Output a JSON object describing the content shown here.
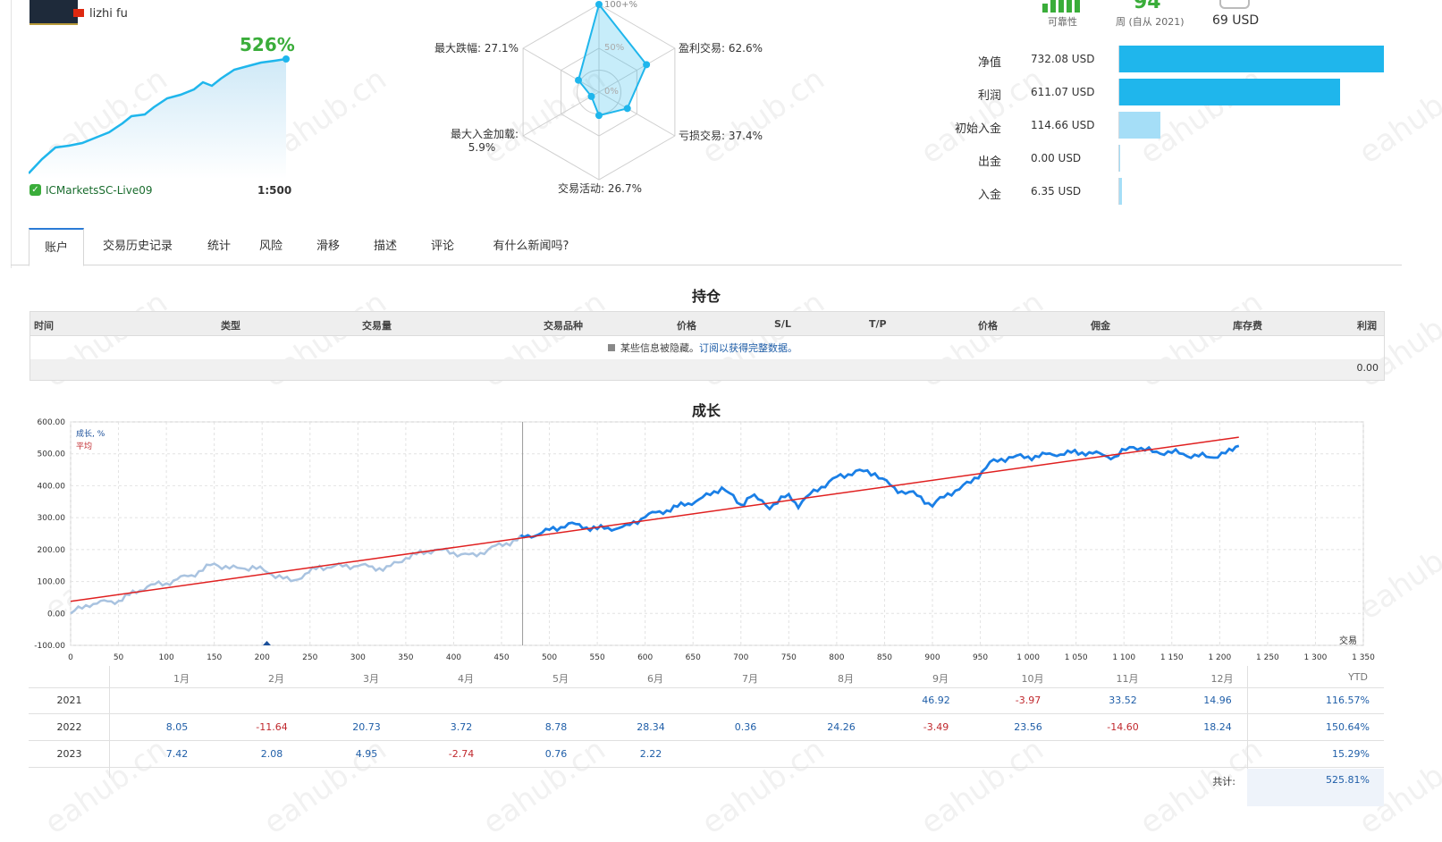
{
  "profile": {
    "user_name": "lizhi fu",
    "growth_pct": "526%",
    "server": "ICMarketsSC-Live09",
    "leverage": "1:500"
  },
  "radar": {
    "labels": {
      "top": "100+%",
      "mid": "50%",
      "center": "0%",
      "drawdown": "最大跌幅: 27.1%",
      "profit_trades": "盈利交易: 62.6%",
      "loss_trades": "亏损交易: 37.4%",
      "deposit_load_line1": "最大入金加载:",
      "deposit_load_line2": "5.9%",
      "activity": "交易活动: 26.7%"
    },
    "values": [
      100,
      62.6,
      37.4,
      26.7,
      5.9,
      27.1
    ]
  },
  "stats": {
    "reliability_label": "可靠性",
    "weeks_value": "94",
    "weeks_label": "周 (自从 2021)",
    "price_value": "69 USD"
  },
  "financials": [
    {
      "label": "净值",
      "value": "732.08 USD",
      "ratio": 1.0,
      "color": "#1fb6ec"
    },
    {
      "label": "利润",
      "value": "611.07 USD",
      "ratio": 0.835,
      "color": "#1fb6ec"
    },
    {
      "label": "初始入金",
      "value": "114.66 USD",
      "ratio": 0.157,
      "color": "#a5def7"
    },
    {
      "label": "出金",
      "value": "0.00 USD",
      "ratio": 0.0,
      "color": "#a5def7"
    },
    {
      "label": "入金",
      "value": "6.35 USD",
      "ratio": 0.009,
      "color": "#a5def7"
    }
  ],
  "tabs": [
    "账户",
    "交易历史记录",
    "统计",
    "风险",
    "滑移",
    "描述",
    "评论",
    "有什么新闻吗?"
  ],
  "positions": {
    "title": "持仓",
    "columns": [
      "时间",
      "类型",
      "交易量",
      "交易品种",
      "价格",
      "S/L",
      "T/P",
      "价格",
      "佣金",
      "库存费",
      "利润"
    ],
    "hidden_notice_prefix": "某些信息被隐藏。",
    "hidden_notice_link": "订阅以获得完整数据。",
    "total": "0.00"
  },
  "growth": {
    "title": "成长",
    "legend_growth": "成长, %",
    "legend_avg": "平均",
    "x_axis_label": "交易",
    "y_ticks": [
      "600.00",
      "500.00",
      "400.00",
      "300.00",
      "200.00",
      "100.00",
      "0.00",
      "-100.00"
    ],
    "x_ticks": [
      "0",
      "50",
      "100",
      "150",
      "200",
      "250",
      "300",
      "350",
      "400",
      "450",
      "500",
      "550",
      "600",
      "650",
      "700",
      "750",
      "800",
      "850",
      "900",
      "950",
      "1 000",
      "1 050",
      "1 100",
      "1 150",
      "1 200",
      "1 250",
      "1 300",
      "1 350"
    ]
  },
  "chart_data": {
    "type": "line",
    "title": "成长",
    "xlabel": "交易",
    "ylabel": "",
    "xlim": [
      0,
      1350
    ],
    "ylim": [
      -100,
      600
    ],
    "series": [
      {
        "name": "成长, %",
        "x": [
          0,
          20,
          50,
          80,
          100,
          130,
          150,
          170,
          190,
          210,
          230,
          260,
          300,
          330,
          350,
          380,
          400,
          420,
          440,
          470,
          500,
          520,
          550,
          580,
          600,
          630,
          660,
          680,
          700,
          710,
          730,
          750,
          760,
          780,
          800,
          820,
          840,
          860,
          880,
          900,
          920,
          940,
          960,
          980,
          1000,
          1030,
          1060,
          1090,
          1110,
          1130,
          1150,
          1170,
          1190,
          1210,
          1220
        ],
        "y": [
          0,
          30,
          40,
          85,
          95,
          125,
          155,
          140,
          145,
          125,
          100,
          145,
          150,
          140,
          175,
          200,
          190,
          180,
          205,
          235,
          260,
          280,
          265,
          270,
          305,
          330,
          360,
          395,
          340,
          370,
          335,
          370,
          340,
          390,
          425,
          445,
          440,
          390,
          375,
          340,
          380,
          410,
          470,
          490,
          490,
          500,
          505,
          490,
          525,
          505,
          505,
          495,
          490,
          505,
          525
        ]
      },
      {
        "name": "平均",
        "x": [
          0,
          1220
        ],
        "y": [
          38,
          552
        ]
      }
    ]
  },
  "monthly": {
    "months": [
      "1月",
      "2月",
      "3月",
      "4月",
      "5月",
      "6月",
      "7月",
      "8月",
      "9月",
      "10月",
      "11月",
      "12月"
    ],
    "ytd_label": "YTD",
    "rows": [
      {
        "year": "2021",
        "values": [
          "",
          "",
          "",
          "",
          "",
          "",
          "",
          "",
          "46.92",
          "-3.97",
          "33.52",
          "14.96"
        ],
        "ytd": "116.57%"
      },
      {
        "year": "2022",
        "values": [
          "8.05",
          "-11.64",
          "20.73",
          "3.72",
          "8.78",
          "28.34",
          "0.36",
          "24.26",
          "-3.49",
          "23.56",
          "-14.60",
          "18.24"
        ],
        "ytd": "150.64%"
      },
      {
        "year": "2023",
        "values": [
          "7.42",
          "2.08",
          "4.95",
          "-2.74",
          "0.76",
          "2.22",
          "",
          "",
          "",
          "",
          "",
          ""
        ],
        "ytd": "15.29%"
      }
    ],
    "total_label": "共计:",
    "total_value": "525.81%"
  }
}
